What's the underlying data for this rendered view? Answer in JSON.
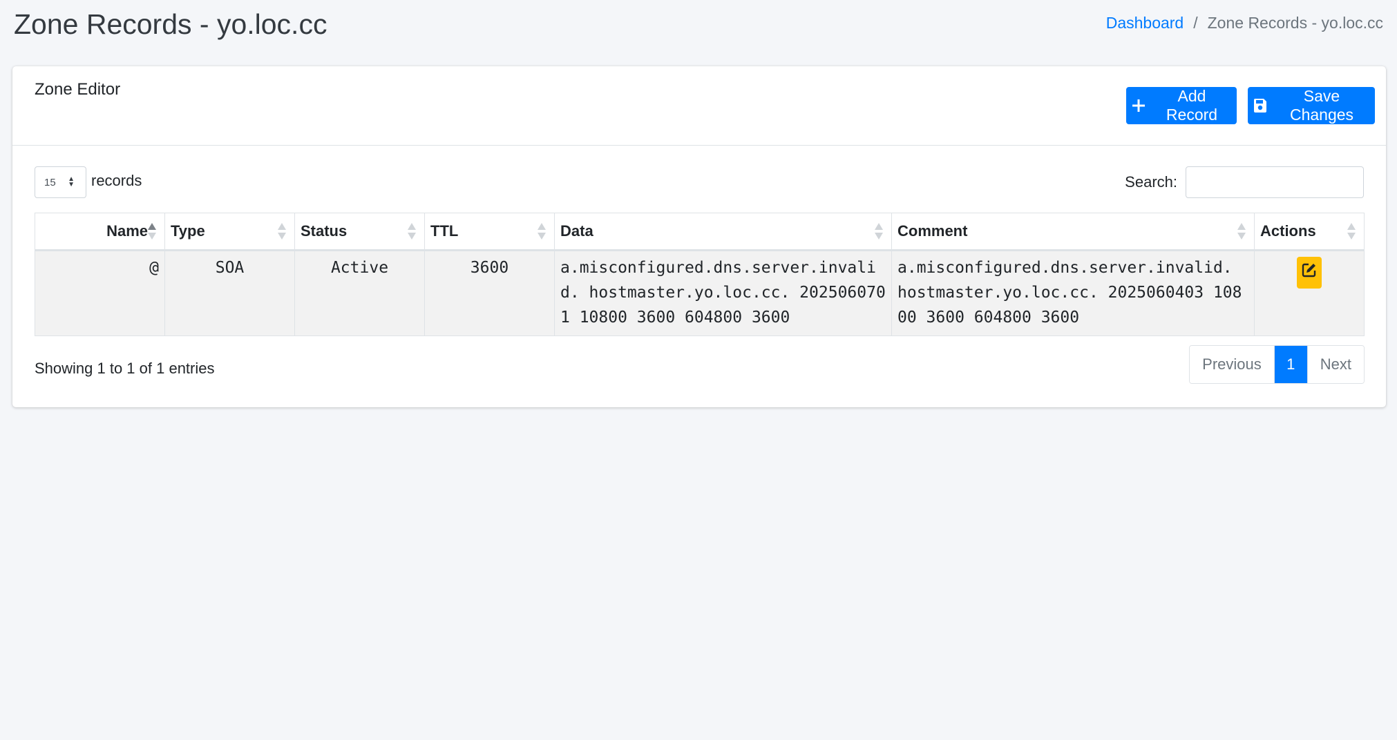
{
  "header": {
    "title": "Zone Records - yo.loc.cc",
    "breadcrumb": {
      "home": "Dashboard",
      "separator": "/",
      "current": "Zone Records - yo.loc.cc"
    }
  },
  "card": {
    "title": "Zone Editor",
    "add_label": "Add Record",
    "save_label": "Save Changes"
  },
  "controls": {
    "length_value": "15",
    "length_label": "records",
    "search_label": "Search:",
    "search_value": ""
  },
  "table": {
    "columns": [
      "Name",
      "Type",
      "Status",
      "TTL",
      "Data",
      "Comment",
      "Actions"
    ],
    "rows": [
      {
        "name": "@",
        "type": "SOA",
        "status": "Active",
        "ttl": "3600",
        "data": "a.misconfigured.dns.server.invalid. hostmaster.yo.loc.cc. 2025060701 10800 3600 604800 3600",
        "comment": "a.misconfigured.dns.server.invalid. hostmaster.yo.loc.cc. 2025060403 10800 3600 604800 3600"
      }
    ]
  },
  "footer": {
    "info": "Showing 1 to 1 of 1 entries",
    "previous": "Previous",
    "page": "1",
    "next": "Next"
  },
  "colors": {
    "primary": "#007bff",
    "warning": "#ffc107",
    "background": "#f4f6f9"
  },
  "icons": {
    "add": "plus-icon",
    "save": "floppy-disk-icon",
    "edit": "pencil-square-icon",
    "length_select": "sort-arrows-icon"
  }
}
